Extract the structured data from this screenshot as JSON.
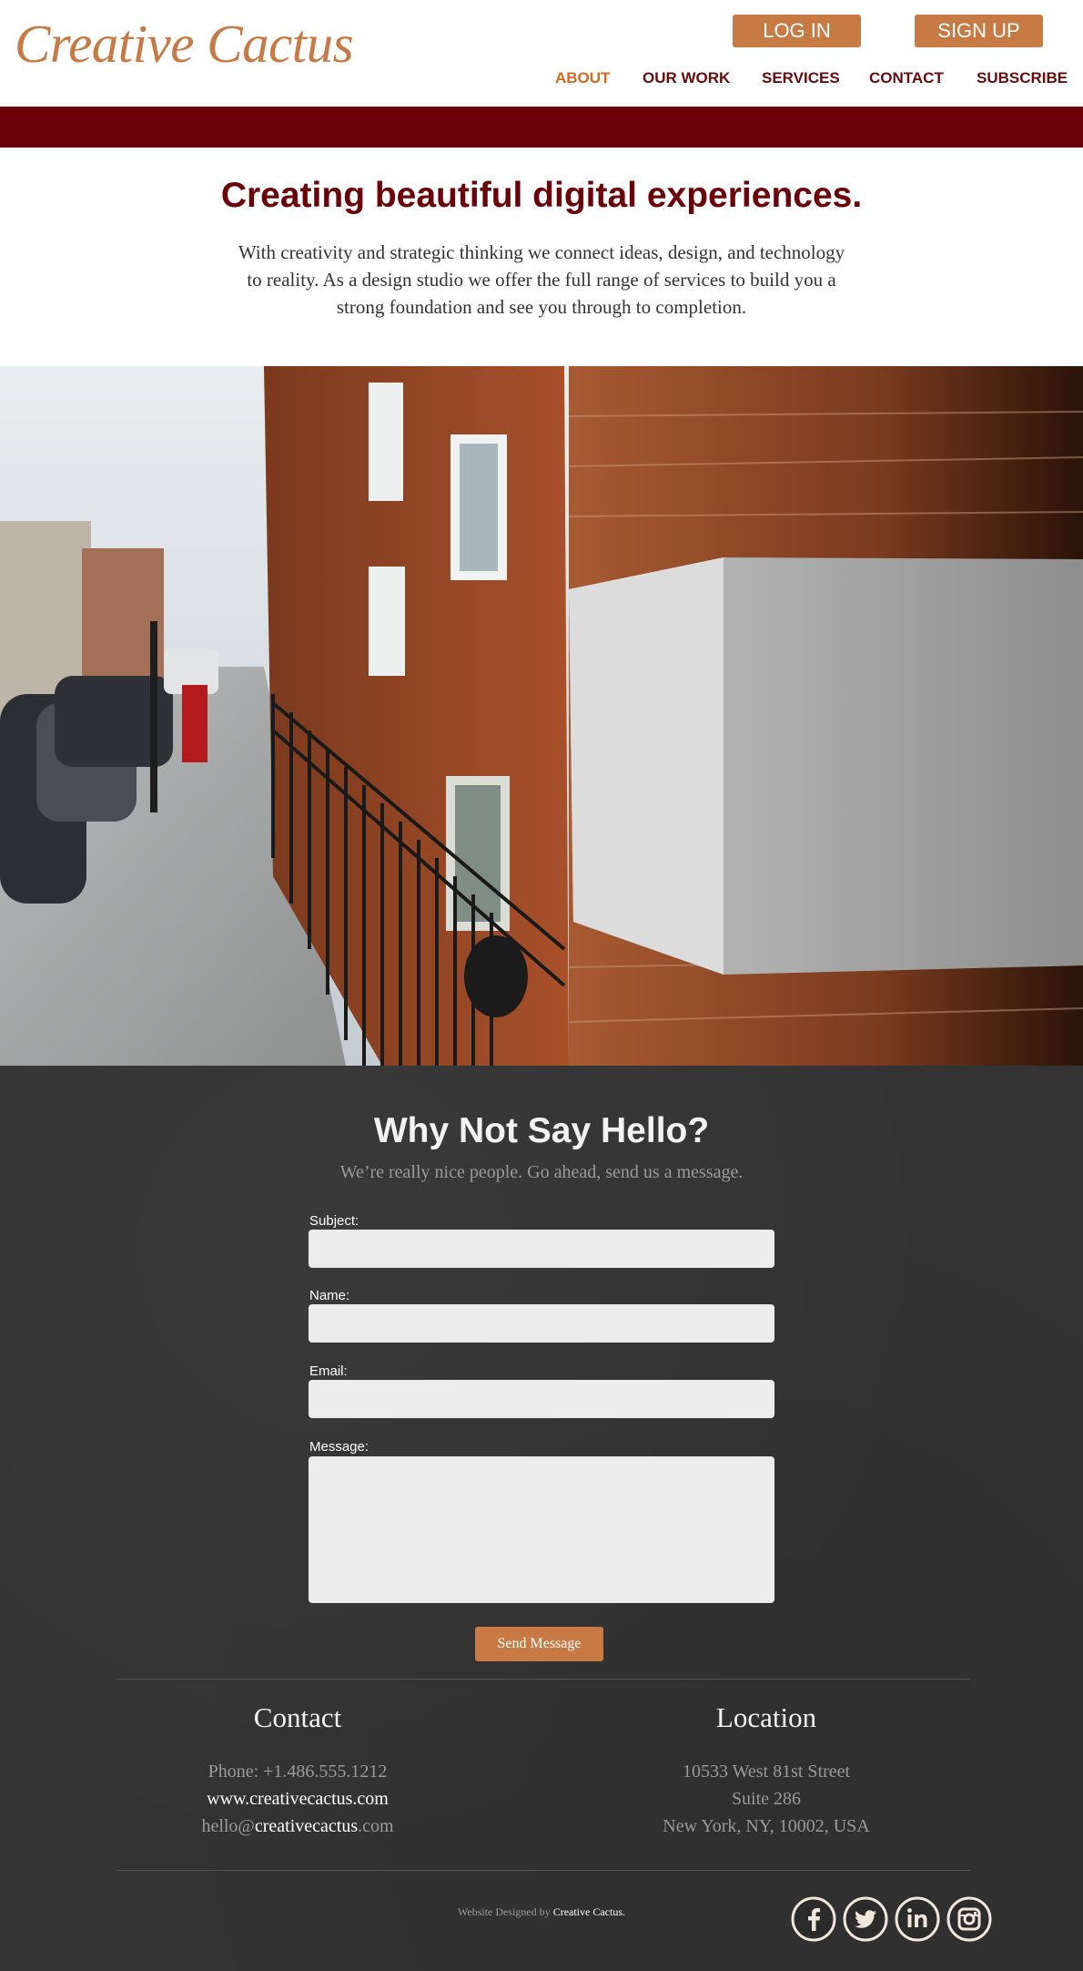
{
  "header": {
    "logo": "Creative Cactus",
    "login_label": "LOG IN",
    "signup_label": "SIGN UP",
    "nav": [
      {
        "label": "ABOUT",
        "active": true
      },
      {
        "label": "OUR WORK",
        "active": false
      },
      {
        "label": "SERVICES",
        "active": false
      },
      {
        "label": "CONTACT",
        "active": false
      },
      {
        "label": "SUBSCRIBE",
        "active": false
      }
    ]
  },
  "hero": {
    "title": "Creating beautiful digital experiences.",
    "text": "With creativity and strategic thinking we connect ideas, design, and technology to reality. As a design studio we offer the full range of services to build you a strong foundation and see you through to completion."
  },
  "contact_form": {
    "title": "Why Not Say Hello?",
    "subtitle": "We’re really nice people. Go ahead, send us a message.",
    "fields": [
      {
        "label": "Subject:",
        "value": ""
      },
      {
        "label": "Name:",
        "value": ""
      },
      {
        "label": "Email:",
        "value": ""
      },
      {
        "label": "Message:",
        "value": ""
      }
    ],
    "send_label": "Send Message"
  },
  "footer": {
    "contact": {
      "title": "Contact",
      "phone": "Phone: +1.486.555.1212",
      "website": "www.creativecactus.com",
      "email_prefix": "hello@",
      "email_domain": "creativecactus",
      "email_suffix": ".com"
    },
    "location": {
      "title": "Location",
      "line1": "10533 West 81st Street",
      "line2": "Suite 286",
      "line3": "New York, NY, 10002, USA"
    },
    "credit_prefix": "Website Designed by ",
    "credit_name": "Creative Cactus.",
    "social": [
      "facebook-icon",
      "twitter-icon",
      "linkedin-icon",
      "instagram-icon"
    ]
  },
  "colors": {
    "accent": "#c87a45",
    "brand_dark": "#6b0008",
    "active_nav": "#d2691e",
    "dark_bg": "#333333"
  }
}
